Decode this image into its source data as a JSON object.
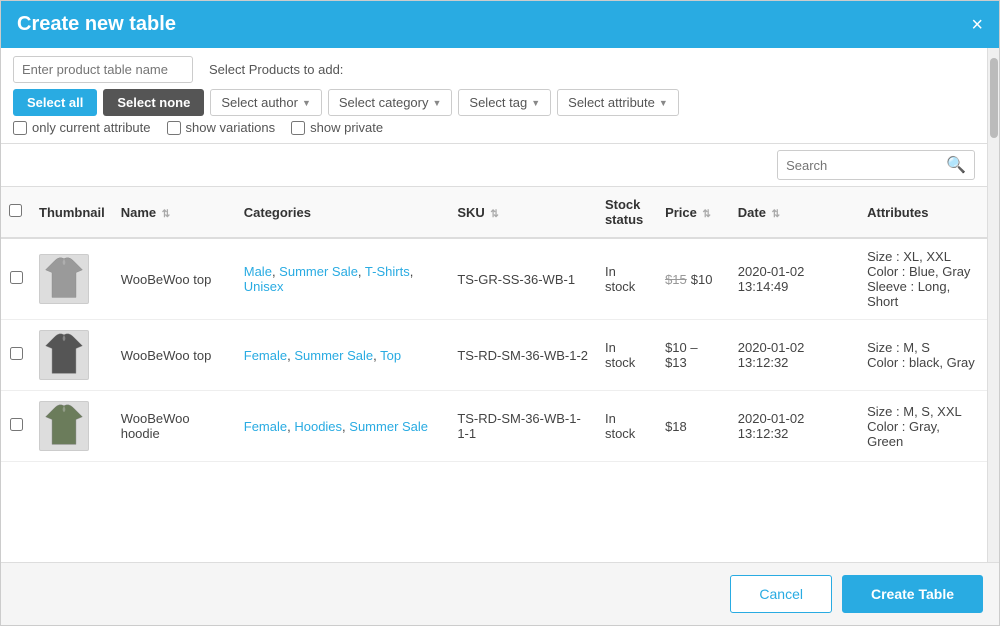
{
  "modal": {
    "title": "Create new table",
    "close_icon": "×"
  },
  "controls": {
    "product_name_placeholder": "Enter product table name",
    "select_products_label": "Select Products to add:",
    "btn_select_all": "Select all",
    "btn_select_none": "Select none",
    "dropdown_author": "Select author",
    "dropdown_category": "Select category",
    "dropdown_tag": "Select tag",
    "dropdown_attribute": "Select attribute",
    "checkbox_only_current": "only current attribute",
    "checkbox_show_variations": "show variations",
    "checkbox_show_private": "show private"
  },
  "search": {
    "placeholder": "Search"
  },
  "table": {
    "columns": [
      {
        "id": "check",
        "label": ""
      },
      {
        "id": "thumbnail",
        "label": "Thumbnail"
      },
      {
        "id": "name",
        "label": "Name"
      },
      {
        "id": "categories",
        "label": "Categories"
      },
      {
        "id": "sku",
        "label": "SKU"
      },
      {
        "id": "stock",
        "label": "Stock status"
      },
      {
        "id": "price",
        "label": "Price"
      },
      {
        "id": "date",
        "label": "Date"
      },
      {
        "id": "attributes",
        "label": "Attributes"
      }
    ],
    "rows": [
      {
        "name": "WooBeWoo top",
        "categories": [
          "Male",
          "Summer Sale",
          "T-Shirts",
          "Unisex"
        ],
        "sku": "TS-GR-SS-36-WB-1",
        "stock": "In stock",
        "price_old": "$15",
        "price_new": "$10",
        "price_range": null,
        "date": "2020-01-02 13:14:49",
        "attributes": "Size : XL, XXL\nColor : Blue, Gray\nSleeve : Long, Short",
        "shirt_color": "gray"
      },
      {
        "name": "WooBeWoo top",
        "categories": [
          "Female",
          "Summer Sale",
          "Top"
        ],
        "sku": "TS-RD-SM-36-WB-1-2",
        "stock": "In stock",
        "price_old": null,
        "price_new": null,
        "price_range": "$10 – $13",
        "date": "2020-01-02 13:12:32",
        "attributes": "Size : M, S\nColor : black, Gray",
        "shirt_color": "dark"
      },
      {
        "name": "WooBeWoo hoodie",
        "categories": [
          "Female",
          "Hoodies",
          "Summer Sale"
        ],
        "sku": "TS-RD-SM-36-WB-1-1-1",
        "stock": "In stock",
        "price_old": null,
        "price_new": null,
        "price_range": "$18",
        "date": "2020-01-02 13:12:32",
        "attributes": "Size : M, S, XXL\nColor : Gray, Green",
        "shirt_color": "green"
      }
    ]
  },
  "footer": {
    "btn_cancel": "Cancel",
    "btn_create": "Create Table"
  },
  "colors": {
    "accent": "#29abe2"
  }
}
